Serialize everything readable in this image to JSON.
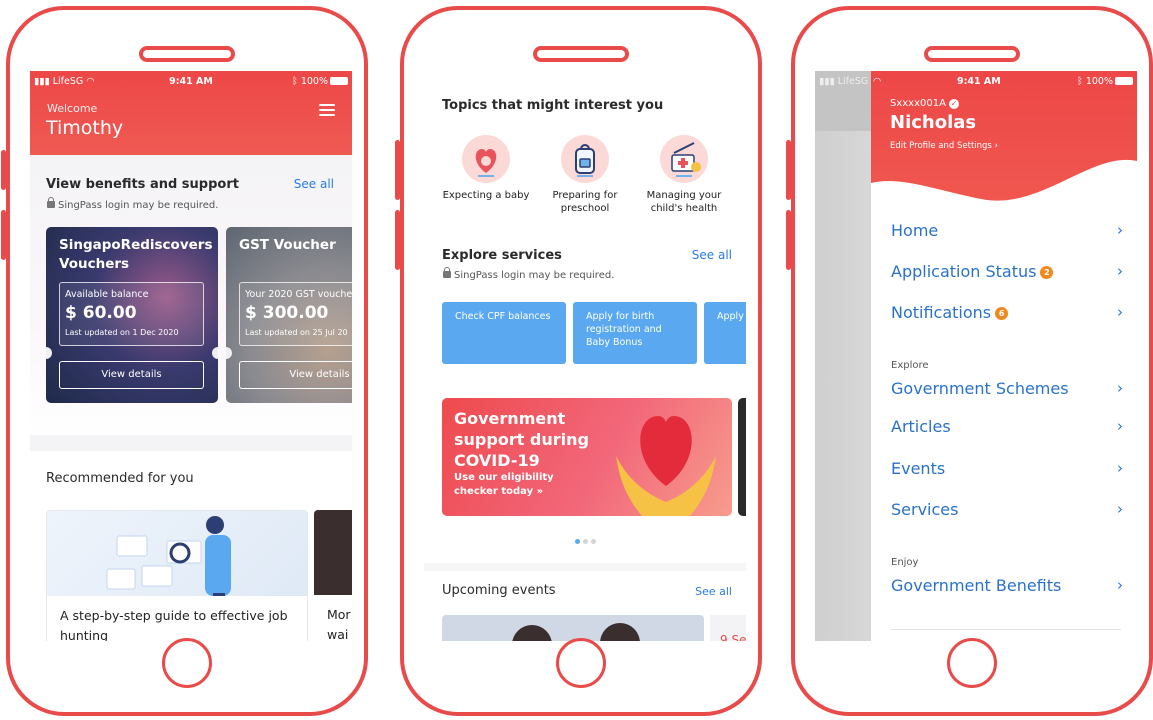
{
  "status_bar": {
    "carrier": "LifeSG",
    "time": "9:41 AM",
    "battery": "100%"
  },
  "phone1": {
    "welcome": "Welcome",
    "name": "Timothy",
    "benefits": {
      "title": "View benefits and support",
      "see_all": "See all",
      "note": "SingPass login may be required.",
      "cards": [
        {
          "title": "SingapoRediscovers Vouchers",
          "balance_label": "Available balance",
          "amount": "$ 60.00",
          "updated": "Last updated on 1 Dec 2020",
          "button": "View details"
        },
        {
          "title": "GST Voucher",
          "balance_label": "Your 2020 GST vouche",
          "amount": "$ 300.00",
          "updated": "Last updated on 25 Jul 20",
          "button": "View details"
        }
      ]
    },
    "recommended": {
      "title": "Recommended for you",
      "articles": [
        {
          "title": "A step-by-step guide to effective job hunting"
        },
        {
          "title": "Mor wai"
        }
      ]
    }
  },
  "phone2": {
    "topics_title": "Topics that might interest you",
    "topics": [
      {
        "label": "Expecting a baby",
        "icon": "pregnancy-icon"
      },
      {
        "label": "Preparing for preschool",
        "icon": "backpack-icon"
      },
      {
        "label": "Managing your child's health",
        "icon": "medical-kit-icon"
      }
    ],
    "services": {
      "title": "Explore services",
      "see_all": "See all",
      "note": "SingPass login may be required.",
      "cards": [
        "Check CPF balances",
        "Apply for birth registration and Baby Bonus",
        "Apply seaso"
      ]
    },
    "banner": {
      "title": "Government support during COVID-19",
      "subtitle": "Use our eligibility checker today »"
    },
    "events": {
      "title": "Upcoming events",
      "see_all": "See all",
      "partial_card_text": "9 Se"
    }
  },
  "phone3": {
    "user_id": "Sxxxx001A",
    "name": "Nicholas",
    "edit_profile": "Edit Profile and Settings",
    "menu": [
      {
        "label": "Home"
      },
      {
        "label": "Application Status",
        "badge": "2"
      },
      {
        "label": "Notifications",
        "badge": "6"
      }
    ],
    "explore_label": "Explore",
    "explore": [
      {
        "label": "Government Schemes"
      },
      {
        "label": "Articles"
      },
      {
        "label": "Events"
      },
      {
        "label": "Services"
      }
    ],
    "enjoy_label": "Enjoy",
    "enjoy": [
      {
        "label": "Government Benefits"
      }
    ]
  },
  "colors": {
    "brand_red": "#ed4747",
    "link_blue": "#2a7be4",
    "service_blue": "#5aa8f0",
    "badge_orange": "#f08a1e"
  }
}
